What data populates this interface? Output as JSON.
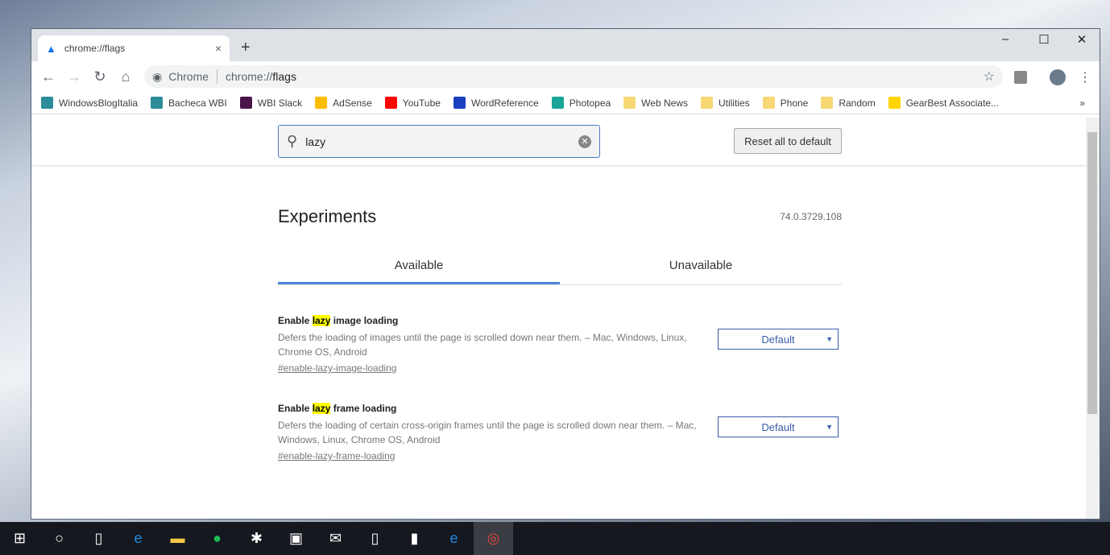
{
  "tab": {
    "title": "chrome://flags",
    "close": "×"
  },
  "new_tab": "+",
  "window_controls": {
    "minimize": "–",
    "maximize": "☐",
    "close": "✕"
  },
  "nav": {
    "back": "←",
    "forward": "→",
    "reload": "↻",
    "home": "⌂"
  },
  "omnibox": {
    "site": "Chrome",
    "url_prefix": "chrome://",
    "url_bold": "flags"
  },
  "bookmarks": [
    {
      "label": "WindowsBlogItalia",
      "color": "#2e8b9a"
    },
    {
      "label": "Bacheca WBI",
      "color": "#2e8b9a"
    },
    {
      "label": "WBI Slack",
      "color": "#4a154b"
    },
    {
      "label": "AdSense",
      "color": "#fbbc04"
    },
    {
      "label": "YouTube",
      "color": "#ff0000"
    },
    {
      "label": "WordReference",
      "color": "#1a3fbf"
    },
    {
      "label": "Photopea",
      "color": "#18a497"
    },
    {
      "label": "Web News",
      "color": "#f8d775"
    },
    {
      "label": "Utilities",
      "color": "#f8d775"
    },
    {
      "label": "Phone",
      "color": "#f8d775"
    },
    {
      "label": "Random",
      "color": "#f8d775"
    },
    {
      "label": "GearBest Associate...",
      "color": "#ffd400"
    }
  ],
  "bookmarks_overflow": "»",
  "search": {
    "value": "lazy"
  },
  "reset_button": "Reset all to default",
  "title": "Experiments",
  "version": "74.0.3729.108",
  "tabs": [
    {
      "label": "Available",
      "active": true
    },
    {
      "label": "Unavailable",
      "active": false
    }
  ],
  "flags": [
    {
      "prefix": "Enable ",
      "match": "lazy",
      "suffix": " image loading",
      "description": "Defers the loading of images until the page is scrolled down near them. – Mac, Windows, Linux, Chrome OS, Android",
      "link": "#enable-lazy-image-loading",
      "value": "Default"
    },
    {
      "prefix": "Enable ",
      "match": "lazy",
      "suffix": " frame loading",
      "description": "Defers the loading of certain cross-origin frames until the page is scrolled down near them. – Mac, Windows, Linux, Chrome OS, Android",
      "link": "#enable-lazy-frame-loading",
      "value": "Default"
    }
  ],
  "colors": {
    "accent": "#4a86d8",
    "highlight": "#ffff00",
    "select": "#3a5ca8"
  },
  "taskbar": [
    "windows-start",
    "cortana",
    "task-view",
    "edge",
    "file-explorer",
    "spotify",
    "slack",
    "store",
    "mail",
    "phone",
    "tablet-app",
    "edge-dev",
    "chrome"
  ]
}
